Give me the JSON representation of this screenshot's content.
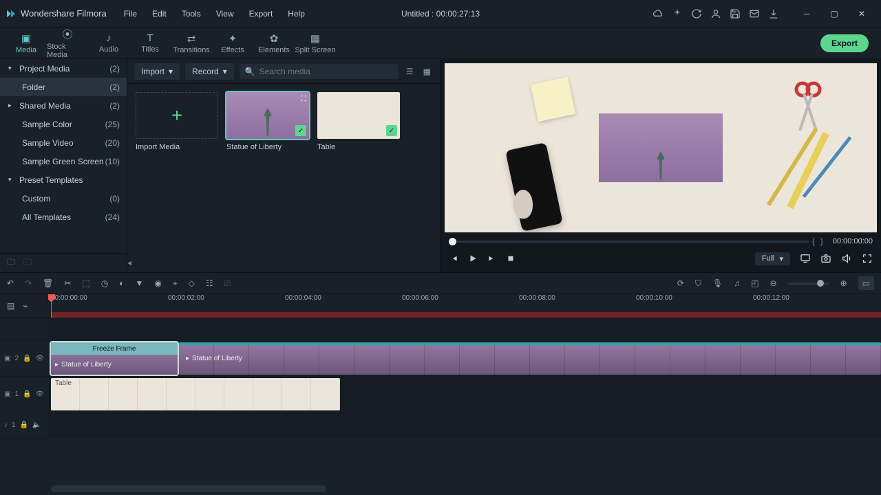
{
  "app": {
    "name": "Wondershare Filmora",
    "document_title": "Untitled : 00:00:27:13"
  },
  "menu": [
    "File",
    "Edit",
    "Tools",
    "View",
    "Export",
    "Help"
  ],
  "window_buttons": [
    "minimize",
    "maximize",
    "close"
  ],
  "titlebar_icons": [
    "cloud",
    "sparkle",
    "refresh",
    "account",
    "save",
    "mail",
    "download"
  ],
  "tabs": [
    {
      "label": "Media",
      "active": true
    },
    {
      "label": "Stock Media"
    },
    {
      "label": "Audio"
    },
    {
      "label": "Titles"
    },
    {
      "label": "Transitions"
    },
    {
      "label": "Effects"
    },
    {
      "label": "Elements"
    },
    {
      "label": "Split Screen"
    }
  ],
  "export_label": "Export",
  "sidebar": [
    {
      "label": "Project Media",
      "count": "(2)",
      "caret": "▾",
      "level": 0,
      "active": false
    },
    {
      "label": "Folder",
      "count": "(2)",
      "level": 1,
      "active": true
    },
    {
      "label": "Shared Media",
      "count": "(2)",
      "caret": "▸",
      "level": 0
    },
    {
      "label": "Sample Color",
      "count": "(25)",
      "level": 1
    },
    {
      "label": "Sample Video",
      "count": "(20)",
      "level": 1
    },
    {
      "label": "Sample Green Screen",
      "count": "(10)",
      "level": 1
    },
    {
      "label": "Preset Templates",
      "count": "",
      "caret": "▾",
      "level": 0
    },
    {
      "label": "Custom",
      "count": "(0)",
      "level": 1
    },
    {
      "label": "All Templates",
      "count": "(24)",
      "level": 1
    }
  ],
  "media_toolbar": {
    "import": "Import",
    "record": "Record",
    "search_placeholder": "Search media"
  },
  "media_items": [
    {
      "kind": "import",
      "label": "Import Media"
    },
    {
      "kind": "clip",
      "label": "Statue of Liberty",
      "selected": true,
      "checked": true,
      "thumb": "statue"
    },
    {
      "kind": "clip",
      "label": "Table",
      "checked": true,
      "thumb": "table"
    }
  ],
  "preview": {
    "timecode": "00:00:00:00",
    "quality": "Full"
  },
  "timeline": {
    "ruler_marks": [
      "00:00:00:00",
      "00:00:02:00",
      "00:00:04:00",
      "00:00:06:00",
      "00:00:08:00",
      "00:00:10:00",
      "00:00:12:00"
    ],
    "tracks": {
      "v2": {
        "name": "2"
      },
      "v1": {
        "name": "1"
      },
      "a1": {
        "name": "1"
      }
    },
    "clips": {
      "freeze_label": "Freeze Frame",
      "freeze_body": "Statue of Liberty",
      "statue2": "Statue of Liberty",
      "table": "Table"
    }
  }
}
